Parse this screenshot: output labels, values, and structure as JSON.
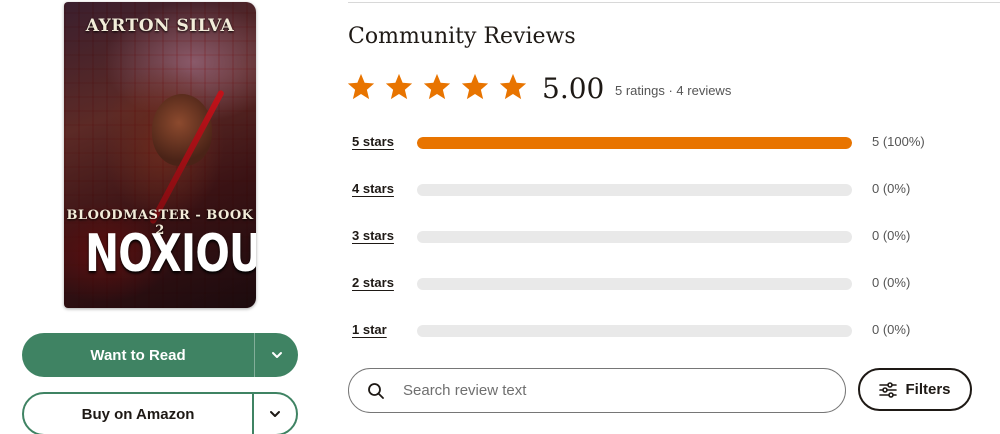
{
  "book": {
    "author": "AYRTON SILVA",
    "series": "BLOODMASTER - BOOK 2",
    "title": "NOXIOUS"
  },
  "actions": {
    "want_to_read": "Want to Read",
    "buy": "Buy on Amazon"
  },
  "reviews": {
    "heading": "Community Reviews",
    "average": "5.00",
    "average_stars": 5,
    "meta": "5 ratings · 4 reviews",
    "histogram": [
      {
        "label": "5 stars",
        "count": "5 (100%)",
        "fraction": 1.0
      },
      {
        "label": "4 stars",
        "count": "0 (0%)",
        "fraction": 0
      },
      {
        "label": "3 stars",
        "count": "0 (0%)",
        "fraction": 0
      },
      {
        "label": "2 stars",
        "count": "0 (0%)",
        "fraction": 0
      },
      {
        "label": "1 star",
        "count": "0 (0%)",
        "fraction": 0
      }
    ]
  },
  "search": {
    "placeholder": "Search review text"
  },
  "filters": {
    "label": "Filters"
  },
  "colors": {
    "brand_green": "#3f8363",
    "star_orange": "#e87400",
    "bar_track": "#e9e9e9"
  },
  "icons": [
    "star-icon",
    "chevron-down-icon",
    "search-icon",
    "filters-icon"
  ]
}
